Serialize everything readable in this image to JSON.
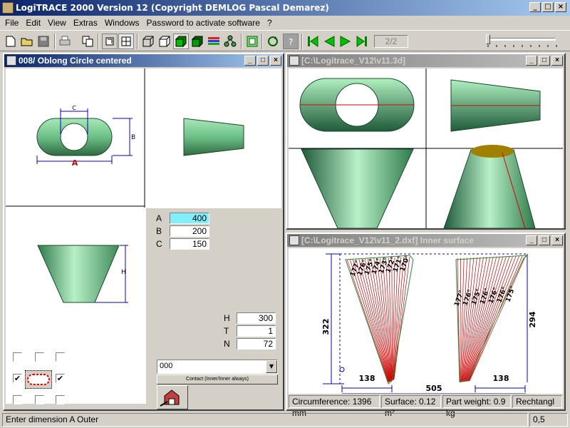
{
  "app": {
    "title": "LogiTRACE 2000  Version 12  (Copyright DEMLOG Pascal Demarez)"
  },
  "menu": [
    "File",
    "Edit",
    "View",
    "Extras",
    "Windows",
    "Password to activate software",
    "?"
  ],
  "toolbar": {
    "page_indicator": "2/2",
    "icons": [
      "new-icon",
      "open-icon",
      "save-icon",
      "print-icon",
      "copy-icon",
      "view2d-icon",
      "view-grid-icon",
      "cube-wire-icon",
      "cube-icon",
      "cube-green-icon",
      "cube-shaded-icon",
      "palette-icon",
      "tree-icon",
      "frame-icon",
      "rotate-icon",
      "info-icon",
      "first-icon",
      "prev-icon",
      "next-icon",
      "last-icon"
    ]
  },
  "left_window": {
    "title": "008/ Oblong Circle centered",
    "fields": [
      {
        "label": "A",
        "value": "400"
      },
      {
        "label": "B",
        "value": "200"
      },
      {
        "label": "C",
        "value": "150"
      }
    ],
    "fields2": [
      {
        "label": "H",
        "value": "300"
      },
      {
        "label": "T",
        "value": "1"
      },
      {
        "label": "N",
        "value": "72"
      }
    ],
    "dim_labels": {
      "a": "A",
      "b": "B",
      "c": "C",
      "h": "H"
    },
    "combo_value": "000",
    "contact_button": "Contact (Inner/Inner always)",
    "checks": [
      "",
      "",
      "",
      "✔",
      "✔",
      "",
      "",
      ""
    ]
  },
  "view3d_window": {
    "title": "[C:\\Logitrace_V12\\v11.3d]"
  },
  "dxf_window": {
    "title": "[C:\\Logitrace_V12\\v11_2.dxf]  Inner surface",
    "dims": {
      "height_left": "322",
      "height_right": "294",
      "bottom_left": "138",
      "bottom_right": "138",
      "total_width": "505"
    },
    "angles_left": [
      "177°",
      "176°",
      "175°",
      "174°",
      "173°",
      "172°",
      "171°",
      "170°"
    ],
    "angles_right": [
      "177°",
      "176°",
      "175°",
      "176°",
      "176°",
      "176°",
      "175°"
    ],
    "status": {
      "circumference": "Circumference: 1396 mm",
      "surface": "Surface: 0.12 m²",
      "weight": "Part weight: 0.9 kg",
      "shape": "Rechtangl"
    }
  },
  "statusbar": {
    "message": "Enter dimension A Outer",
    "value": "0,5"
  },
  "colors": {
    "part_green": "#7fd49a",
    "title_active": "#0a246a",
    "dim_blue": "#0000c0",
    "dim_red": "#cc0000"
  }
}
